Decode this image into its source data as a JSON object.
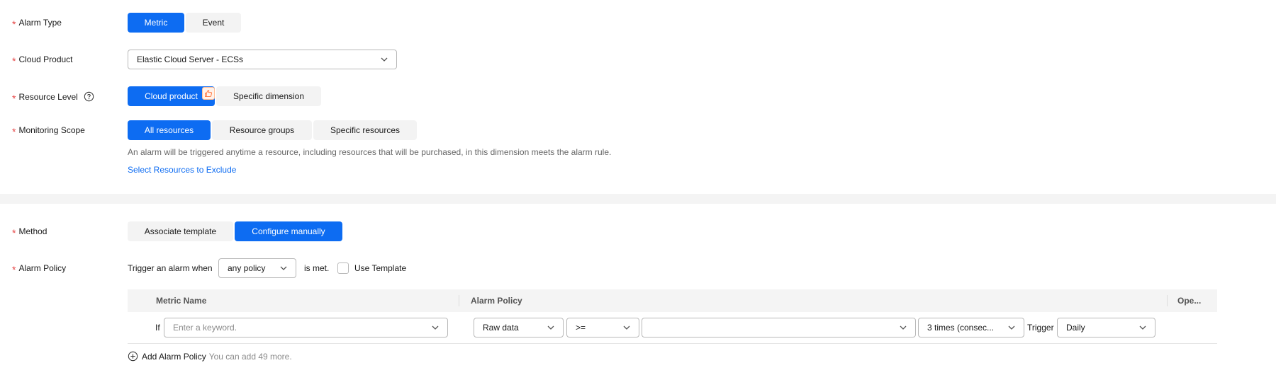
{
  "alarm_type": {
    "label": "Alarm Type",
    "options": [
      "Metric",
      "Event"
    ],
    "selected": "Metric"
  },
  "cloud_product": {
    "label": "Cloud Product",
    "value": "Elastic Cloud Server - ECSs"
  },
  "resource_level": {
    "label": "Resource Level",
    "options": [
      "Cloud product",
      "Specific dimension"
    ],
    "selected": "Cloud product",
    "recommended_icon": "thumbs-up-icon",
    "help_icon": "question-circle-icon"
  },
  "monitoring_scope": {
    "label": "Monitoring Scope",
    "options": [
      "All resources",
      "Resource groups",
      "Specific resources"
    ],
    "selected": "All resources",
    "hint": "An alarm will be triggered anytime a resource, including resources that will be purchased, in this dimension meets the alarm rule.",
    "exclude_link": "Select Resources to Exclude"
  },
  "method": {
    "label": "Method",
    "options": [
      "Associate template",
      "Configure manually"
    ],
    "selected": "Configure manually"
  },
  "alarm_policy": {
    "label": "Alarm Policy",
    "trigger_prefix": "Trigger an alarm when",
    "trigger_value": "any policy",
    "trigger_suffix": "is met.",
    "use_template_label": "Use Template",
    "table": {
      "columns": [
        "Metric Name",
        "Alarm Policy",
        "Ope..."
      ],
      "row": {
        "if_label": "If",
        "metric_placeholder": "Enter a keyword.",
        "data_type": "Raw data",
        "operator": ">=",
        "threshold": "",
        "frequency": "3 times (consec...",
        "trigger_label": "Trigger",
        "trigger_period": "Daily"
      }
    },
    "add_label": "Add Alarm Policy",
    "add_hint": "You can add 49 more."
  },
  "colors": {
    "primary": "#0d6cf2",
    "required": "#e54545",
    "segment_bg": "#f3f3f3",
    "badge": "#ff7a45"
  }
}
